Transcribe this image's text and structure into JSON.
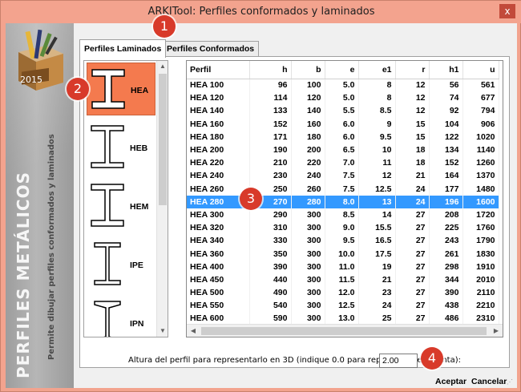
{
  "window": {
    "title": "ARKITool: Perfiles conformados y laminados",
    "close_glyph": "x",
    "bg_color": "#f3a38e"
  },
  "banner": {
    "logo_year": "2015",
    "title": "PERFILES METÁLICOS",
    "subtitle": "Permite dibujar perfiles conformados y laminados"
  },
  "tabs": [
    {
      "label": "Perfiles Laminados",
      "active": true
    },
    {
      "label": "Perfiles Conformados",
      "active": false
    }
  ],
  "profiles": [
    {
      "label": "HEA",
      "icon": "wide-flange-beam-icon",
      "selected": true
    },
    {
      "label": "HEB",
      "icon": "wide-flange-beam-icon",
      "selected": false
    },
    {
      "label": "HEM",
      "icon": "wide-flange-beam-icon",
      "selected": false
    },
    {
      "label": "IPE",
      "icon": "i-beam-icon",
      "selected": false
    },
    {
      "label": "IPN",
      "icon": "tapered-i-beam-icon",
      "selected": false
    }
  ],
  "table": {
    "columns": [
      "Perfil",
      "h",
      "b",
      "e",
      "e1",
      "r",
      "h1",
      "u"
    ],
    "selected_row": 9,
    "rows": [
      [
        "HEA 100",
        "96",
        "100",
        "5.0",
        "8",
        "12",
        "56",
        "561"
      ],
      [
        "HEA 120",
        "114",
        "120",
        "5.0",
        "8",
        "12",
        "74",
        "677"
      ],
      [
        "HEA 140",
        "133",
        "140",
        "5.5",
        "8.5",
        "12",
        "92",
        "794"
      ],
      [
        "HEA 160",
        "152",
        "160",
        "6.0",
        "9",
        "15",
        "104",
        "906"
      ],
      [
        "HEA 180",
        "171",
        "180",
        "6.0",
        "9.5",
        "15",
        "122",
        "1020"
      ],
      [
        "HEA 200",
        "190",
        "200",
        "6.5",
        "10",
        "18",
        "134",
        "1140"
      ],
      [
        "HEA 220",
        "210",
        "220",
        "7.0",
        "11",
        "18",
        "152",
        "1260"
      ],
      [
        "HEA 240",
        "230",
        "240",
        "7.5",
        "12",
        "21",
        "164",
        "1370"
      ],
      [
        "HEA 260",
        "250",
        "260",
        "7.5",
        "12.5",
        "24",
        "177",
        "1480"
      ],
      [
        "HEA 280",
        "270",
        "280",
        "8.0",
        "13",
        "24",
        "196",
        "1600"
      ],
      [
        "HEA 300",
        "290",
        "300",
        "8.5",
        "14",
        "27",
        "208",
        "1720"
      ],
      [
        "HEA 320",
        "310",
        "300",
        "9.0",
        "15.5",
        "27",
        "225",
        "1760"
      ],
      [
        "HEA 340",
        "330",
        "300",
        "9.5",
        "16.5",
        "27",
        "243",
        "1790"
      ],
      [
        "HEA 360",
        "350",
        "300",
        "10.0",
        "17.5",
        "27",
        "261",
        "1830"
      ],
      [
        "HEA 400",
        "390",
        "300",
        "11.0",
        "19",
        "27",
        "298",
        "1910"
      ],
      [
        "HEA 450",
        "440",
        "300",
        "11.5",
        "21",
        "27",
        "344",
        "2010"
      ],
      [
        "HEA 500",
        "490",
        "300",
        "12.0",
        "23",
        "27",
        "390",
        "2110"
      ],
      [
        "HEA 550",
        "540",
        "300",
        "12.5",
        "24",
        "27",
        "438",
        "2210"
      ],
      [
        "HEA 600",
        "590",
        "300",
        "13.0",
        "25",
        "27",
        "486",
        "2310"
      ]
    ]
  },
  "height": {
    "label": "Altura del perfil para representarlo en 3D (indique 0.0 para representar en planta):",
    "value": "2.00"
  },
  "buttons": {
    "accept": "Aceptar",
    "cancel": "Cancelar"
  },
  "markers": [
    "1",
    "2",
    "3",
    "4"
  ],
  "colors": {
    "selection": "#3399ff",
    "profile_selected": "#f47a4e",
    "marker": "#d83a2a"
  }
}
